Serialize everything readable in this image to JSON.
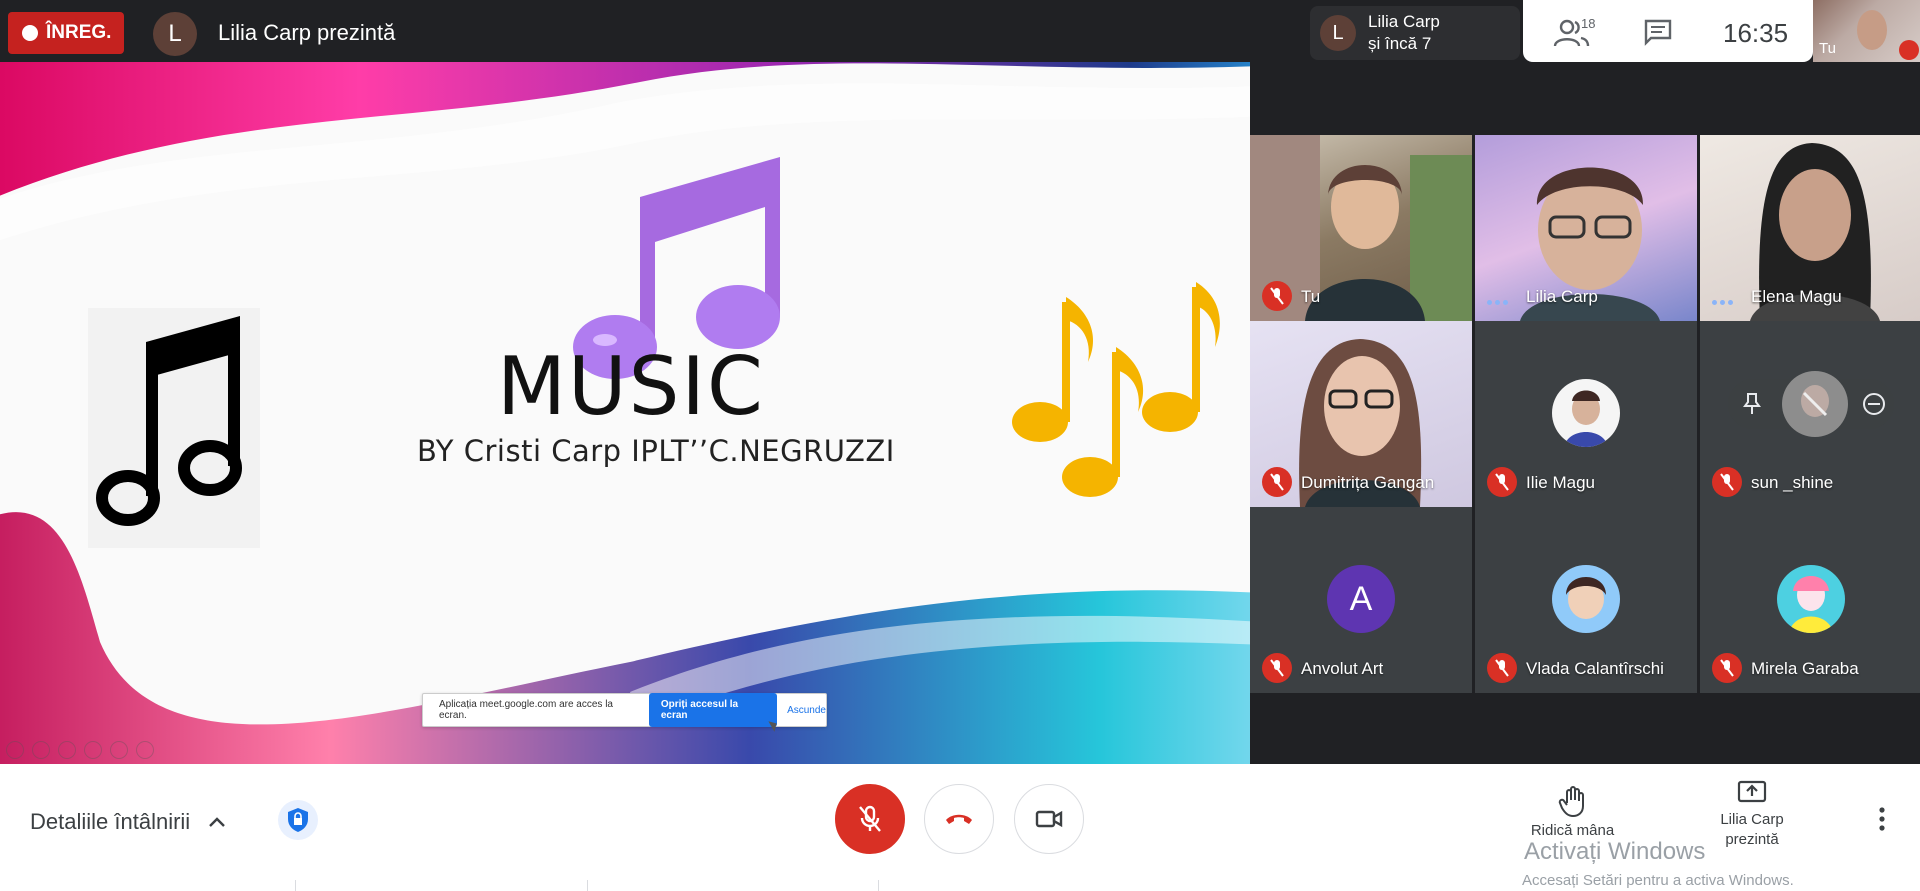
{
  "topbar": {
    "rec_label": "ÎNREG.",
    "presenter_initial": "L",
    "presenter_text": "Lilia Carp prezintă",
    "others_initial": "L",
    "others_line1": "Lilia Carp",
    "others_line2": "și încă 7",
    "people_count": "18",
    "clock": "16:35",
    "self_label": "Tu"
  },
  "slide": {
    "title": "MUSIC",
    "subtitle": "BY Cristi Carp IPLT’’C.NEGRUZZI",
    "share_text": "Aplicația meet.google.com are acces la ecran.",
    "share_stop": "Opriți accesul la ecran",
    "share_hide": "Ascunde"
  },
  "tiles": [
    {
      "name": "Tu",
      "muted": true
    },
    {
      "name": "Lilia Carp",
      "muted": false
    },
    {
      "name": "Elena Magu",
      "muted": false
    },
    {
      "name": "Dumitrița Gangan",
      "muted": true
    },
    {
      "name": "Ilie Magu",
      "muted": true
    },
    {
      "name": "sun _shine",
      "muted": true
    },
    {
      "name": "Anvolut Art",
      "muted": true,
      "initial": "A"
    },
    {
      "name": "Vlada Calantîrschi",
      "muted": true
    },
    {
      "name": "Mirela Garaba",
      "muted": true
    }
  ],
  "bottombar": {
    "details": "Detaliile întâlnirii",
    "raise_hand": "Ridică mâna",
    "present_line1": "Lilia Carp",
    "present_line2": "prezintă",
    "watermark_title": "Activați Windows",
    "watermark_sub": "Accesați Setări pentru a activa Windows."
  },
  "colors": {
    "rec": "#c5221f",
    "mute_red": "#d93025",
    "accent_blue": "#1a73e8",
    "dark_bg": "#202124"
  }
}
